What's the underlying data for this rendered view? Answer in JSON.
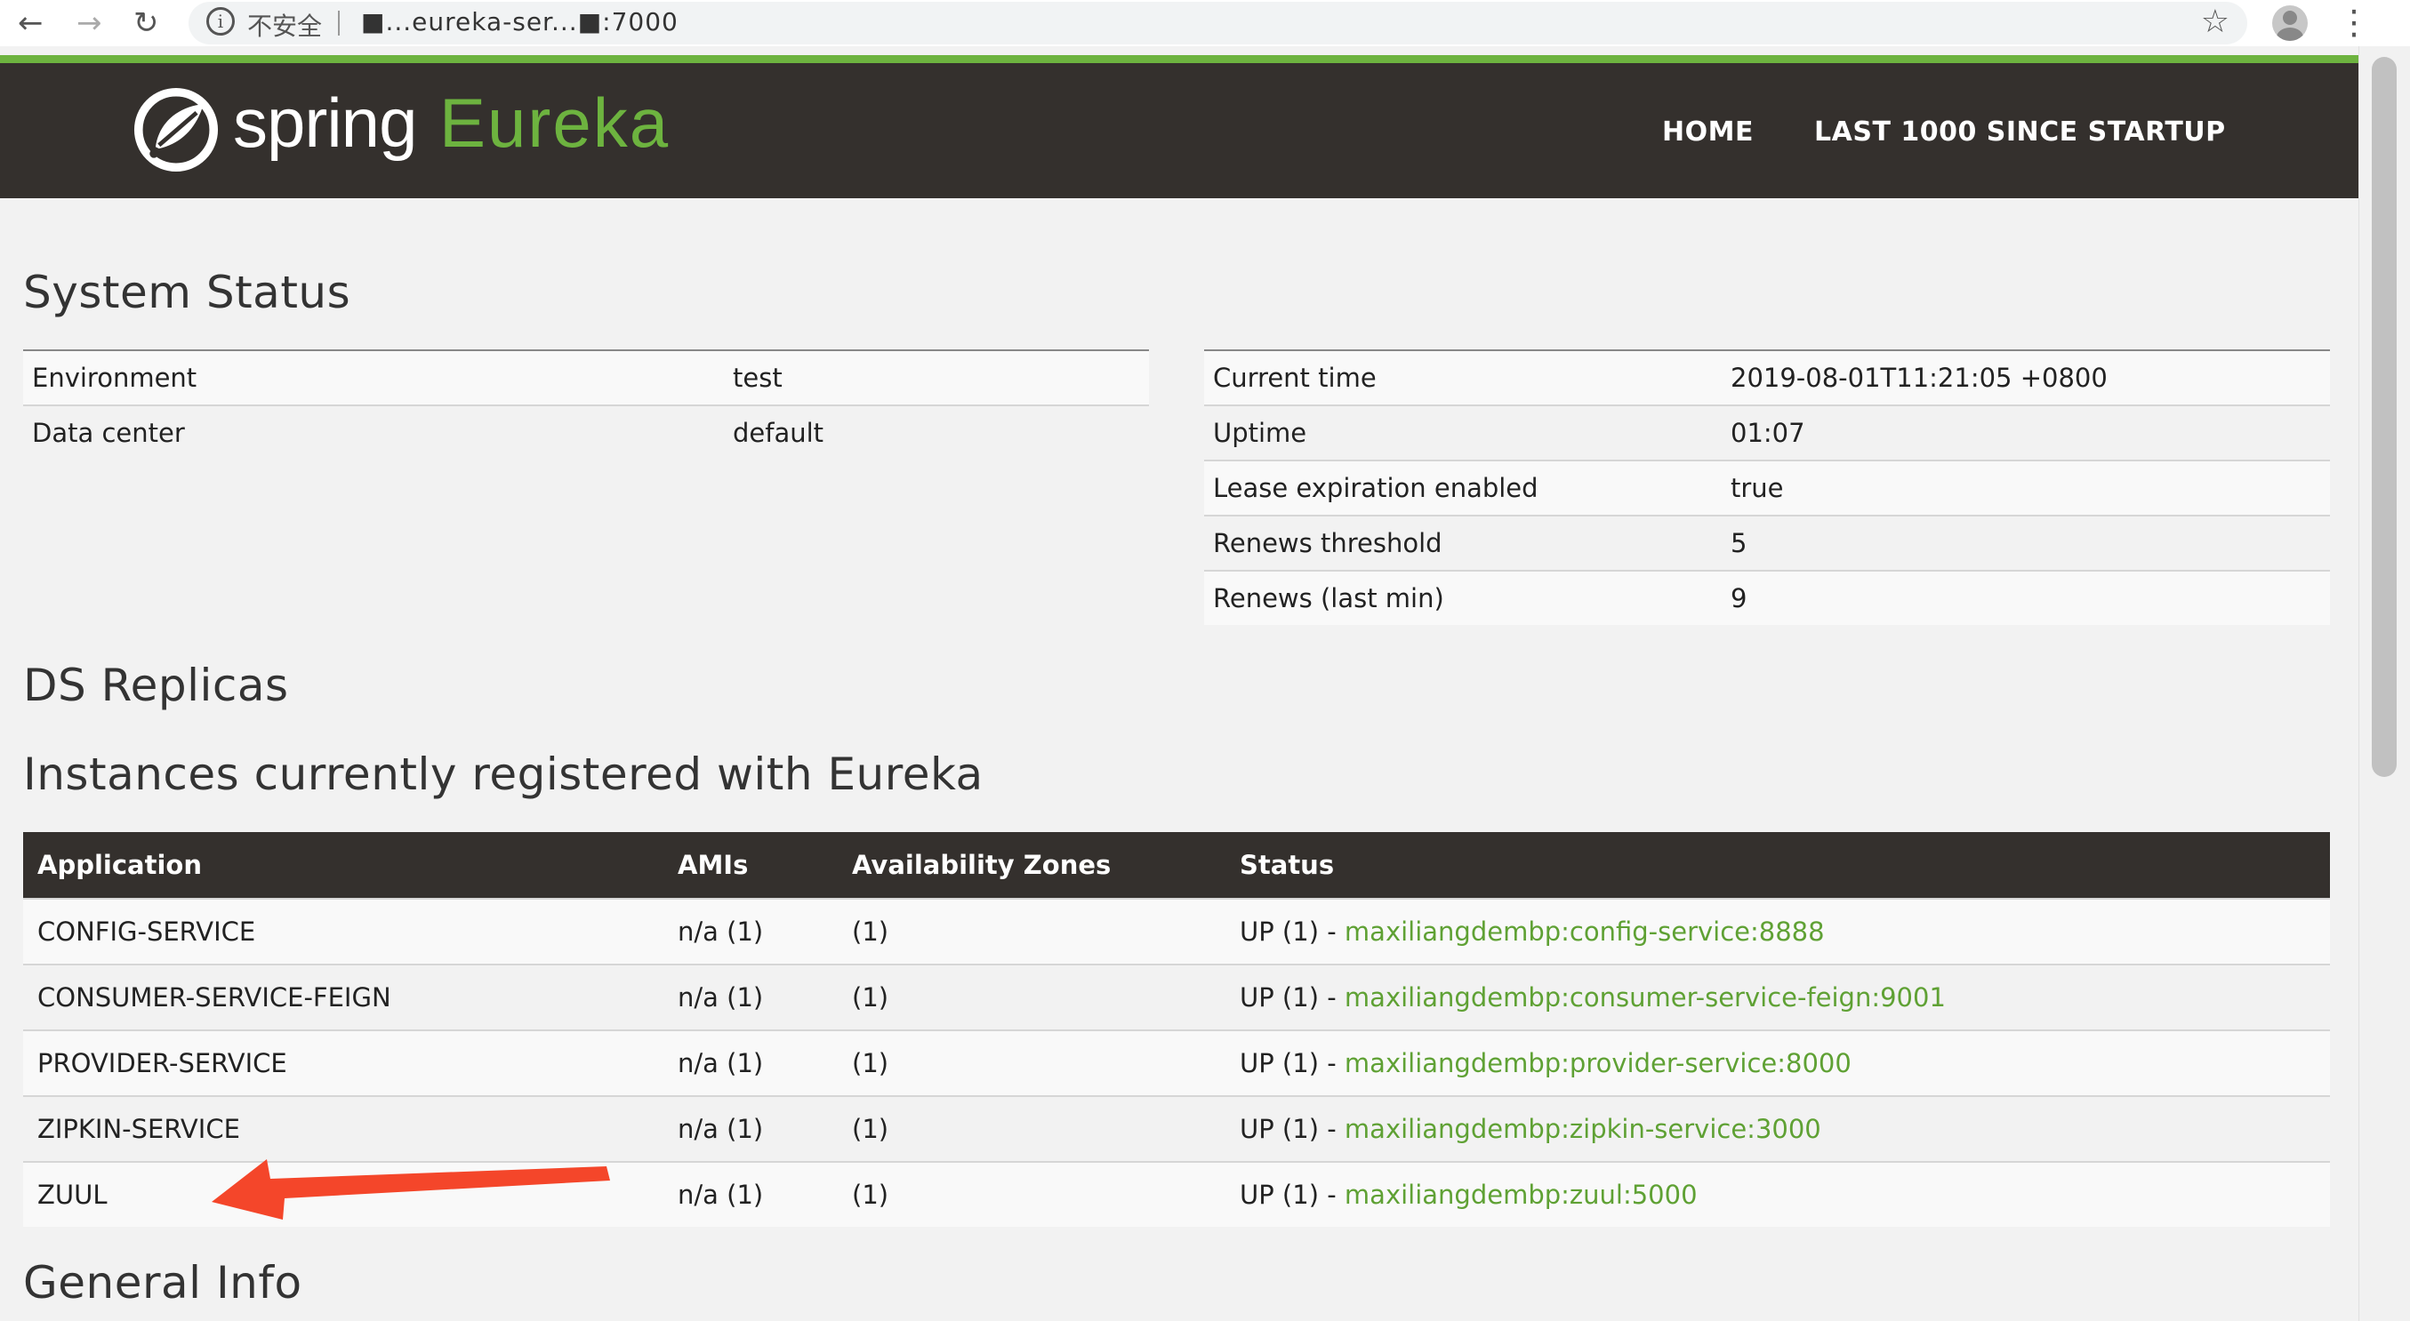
{
  "browser": {
    "security_label": "不安全",
    "url": "■...eureka-ser...■:7000"
  },
  "header": {
    "brand_word": "spring",
    "brand_product": "Eureka",
    "nav": [
      {
        "label": "HOME"
      },
      {
        "label": "LAST 1000 SINCE STARTUP"
      }
    ]
  },
  "system_status": {
    "title": "System Status",
    "left": [
      {
        "key": "Environment",
        "value": "test"
      },
      {
        "key": "Data center",
        "value": "default"
      }
    ],
    "right": [
      {
        "key": "Current time",
        "value": "2019-08-01T11:21:05 +0800"
      },
      {
        "key": "Uptime",
        "value": "01:07"
      },
      {
        "key": "Lease expiration enabled",
        "value": "true"
      },
      {
        "key": "Renews threshold",
        "value": "5"
      },
      {
        "key": "Renews (last min)",
        "value": "9"
      }
    ]
  },
  "ds_replicas": {
    "title": "DS Replicas"
  },
  "instances": {
    "title": "Instances currently registered with Eureka",
    "columns": [
      "Application",
      "AMIs",
      "Availability Zones",
      "Status"
    ],
    "rows": [
      {
        "application": "CONFIG-SERVICE",
        "amis": "n/a (1)",
        "zones": "(1)",
        "status_prefix": "UP (1) - ",
        "status_link": "maxiliangdembp:config-service:8888"
      },
      {
        "application": "CONSUMER-SERVICE-FEIGN",
        "amis": "n/a (1)",
        "zones": "(1)",
        "status_prefix": "UP (1) - ",
        "status_link": "maxiliangdembp:consumer-service-feign:9001"
      },
      {
        "application": "PROVIDER-SERVICE",
        "amis": "n/a (1)",
        "zones": "(1)",
        "status_prefix": "UP (1) - ",
        "status_link": "maxiliangdembp:provider-service:8000"
      },
      {
        "application": "ZIPKIN-SERVICE",
        "amis": "n/a (1)",
        "zones": "(1)",
        "status_prefix": "UP (1) - ",
        "status_link": "maxiliangdembp:zipkin-service:3000"
      },
      {
        "application": "ZUUL",
        "amis": "n/a (1)",
        "zones": "(1)",
        "status_prefix": "UP (1) - ",
        "status_link": "maxiliangdembp:zuul:5000"
      }
    ]
  },
  "general_info": {
    "title": "General Info"
  },
  "colors": {
    "header_bg": "#34302d",
    "accent_green": "#6db33f",
    "link_green": "#5fa134",
    "annotation_arrow": "#f4462a"
  }
}
